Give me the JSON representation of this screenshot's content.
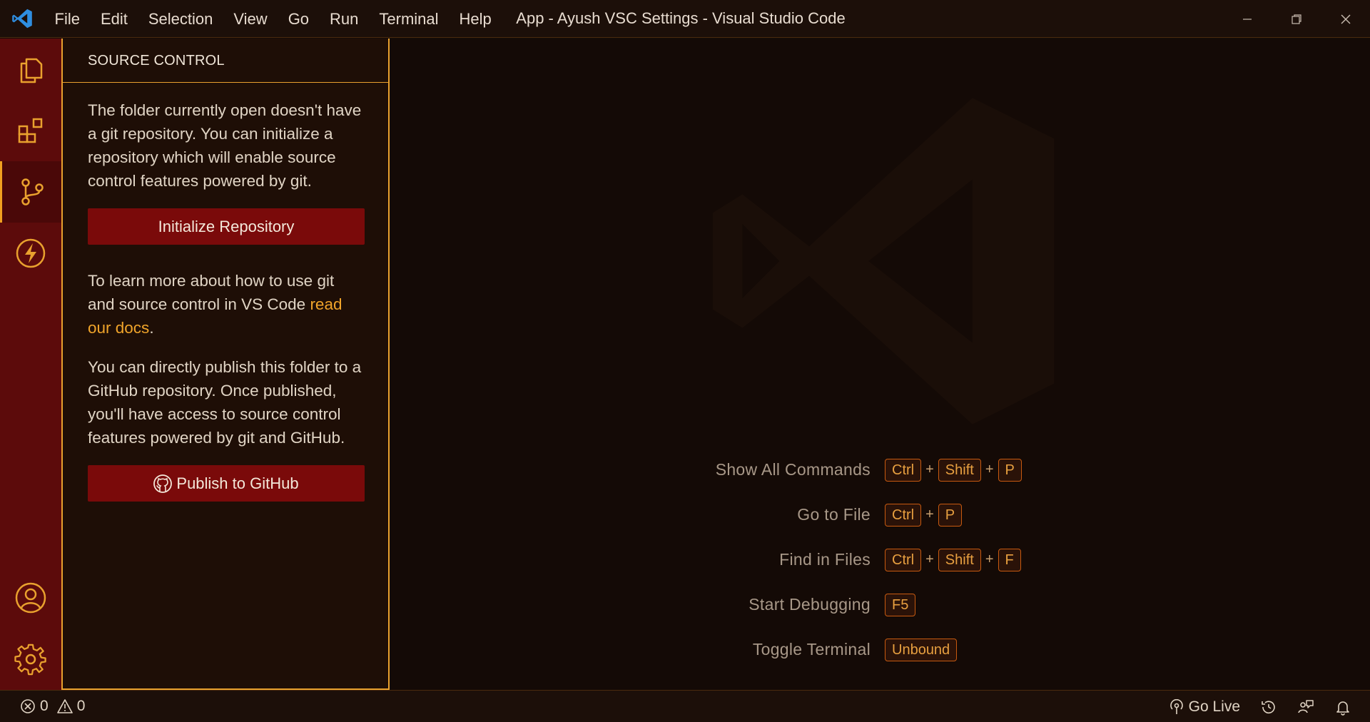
{
  "titlebar": {
    "menu": [
      "File",
      "Edit",
      "Selection",
      "View",
      "Go",
      "Run",
      "Terminal",
      "Help"
    ],
    "title": "App - Ayush VSC Settings - Visual Studio Code"
  },
  "activitybar": {
    "items": [
      "explorer-icon",
      "extensions-icon",
      "source-control-icon",
      "run-debug-icon"
    ],
    "bottom": [
      "account-icon",
      "settings-gear-icon"
    ],
    "active": "source-control-icon"
  },
  "sidebar": {
    "header": "SOURCE CONTROL",
    "intro": "The folder currently open doesn't have a git repository. You can initialize a repository which will enable source control features powered by git.",
    "init_button": "Initialize Repository",
    "learn_prefix": "To learn more about how to use git and source control in VS Code ",
    "learn_link": "read our docs",
    "learn_suffix": ".",
    "publish_text": "You can directly publish this folder to a GitHub repository. Once published, you'll have access to source control features powered by git and GitHub.",
    "publish_button": "Publish to GitHub"
  },
  "editor": {
    "shortcuts": [
      {
        "label": "Show All Commands",
        "keys": [
          "Ctrl",
          "Shift",
          "P"
        ]
      },
      {
        "label": "Go to File",
        "keys": [
          "Ctrl",
          "P"
        ]
      },
      {
        "label": "Find in Files",
        "keys": [
          "Ctrl",
          "Shift",
          "F"
        ]
      },
      {
        "label": "Start Debugging",
        "keys": [
          "F5"
        ]
      },
      {
        "label": "Toggle Terminal",
        "keys": [
          "Unbound"
        ]
      }
    ]
  },
  "statusbar": {
    "errors": "0",
    "warnings": "0",
    "go_live": "Go Live"
  },
  "colors": {
    "accent": "#e9a12e",
    "activitybar": "#5c0b0b",
    "button": "#7a0a0a",
    "link": "#f0a42a"
  }
}
